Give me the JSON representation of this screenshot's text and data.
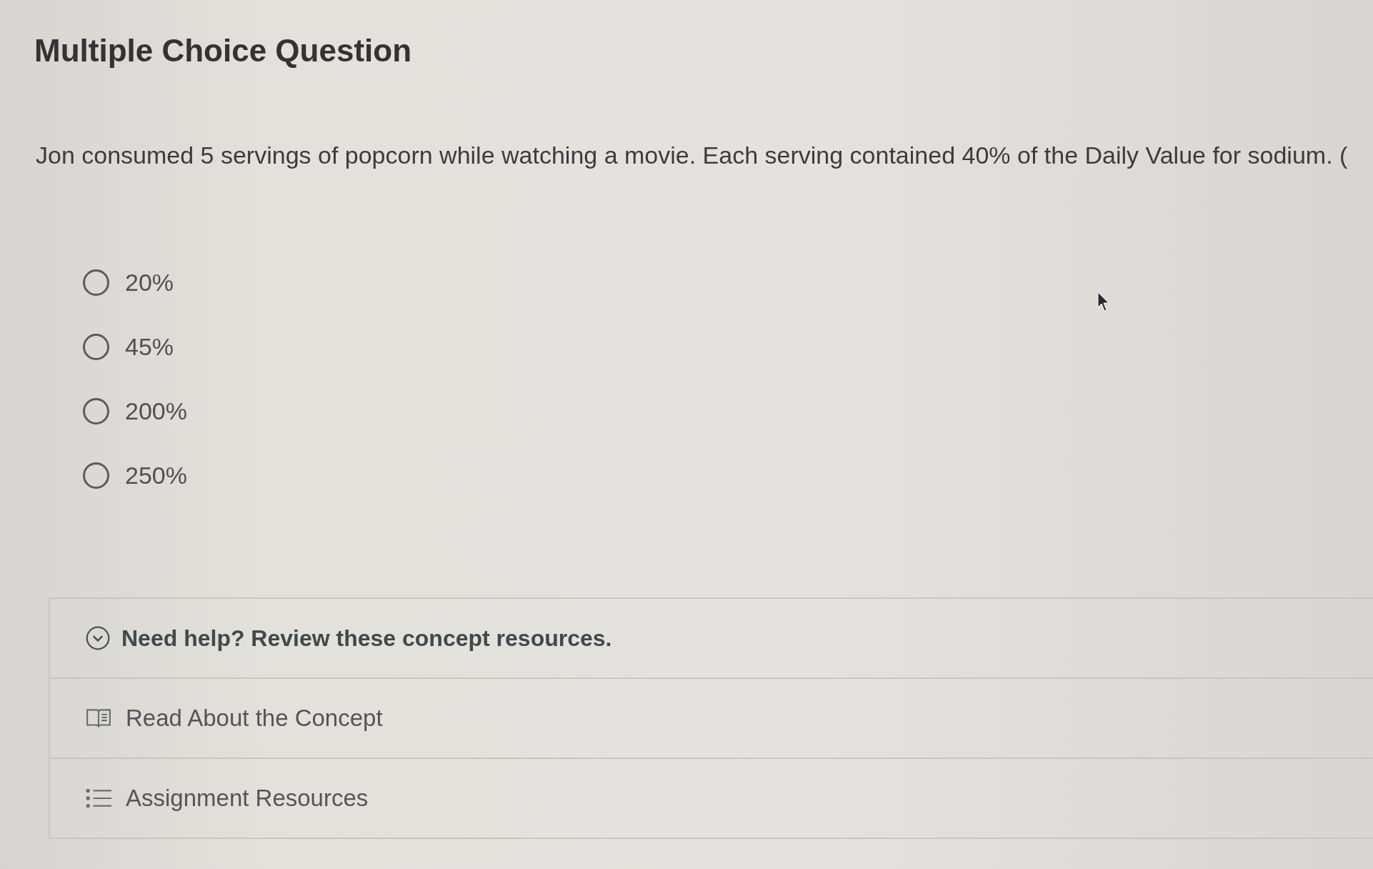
{
  "title": "Multiple Choice Question",
  "question": "Jon consumed 5 servings of popcorn while watching a movie. Each serving contained 40% of the Daily Value for sodium. (",
  "options": [
    {
      "label": "20%",
      "selected": false
    },
    {
      "label": "45%",
      "selected": false
    },
    {
      "label": "200%",
      "selected": false
    },
    {
      "label": "250%",
      "selected": false
    }
  ],
  "help": {
    "heading": "Need help? Review these concept resources.",
    "expanded": true,
    "resources": [
      {
        "kind": "book",
        "label": "Read About the Concept"
      },
      {
        "kind": "list",
        "label": "Assignment Resources"
      }
    ]
  }
}
